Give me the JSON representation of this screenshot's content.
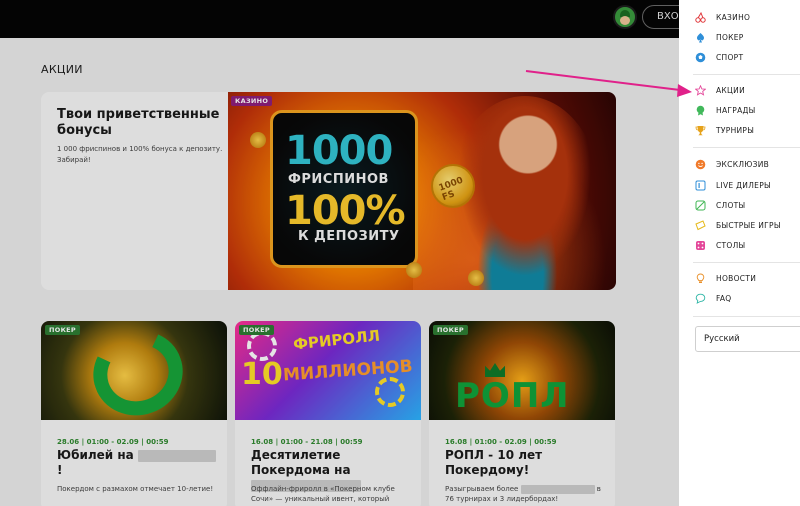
{
  "header": {
    "login_label": "ВХОД"
  },
  "page": {
    "title": "АКЦИИ"
  },
  "hero": {
    "badge": "КАЗИНО",
    "title": "Твои приветственные бонусы",
    "text": "1 000 фриспинов и 100% бонуса к депозиту. Забирай!",
    "image_text": {
      "line1": "1000",
      "line2": "ФРИСПИНОВ",
      "line3": "100%",
      "line4": "К ДЕПОЗИТУ",
      "coin": "1000 FS"
    }
  },
  "cards": [
    {
      "badge": "ПОКЕР",
      "date": "28.06 | 01:00 - 02.09 | 00:59",
      "title_start": "Юбилей на",
      "title_end": "!",
      "text": "Покердом с размахом отмечает 10-летие!"
    },
    {
      "badge": "ПОКЕР",
      "date": "16.08 | 01:00 - 21.08 | 00:59",
      "title_start": "Десятилетие Покердома на",
      "text": "Оффлайн-фриролл в «Покерном клубе Сочи» — уникальный ивент, который нельзя",
      "image_text": {
        "line1": "ФРИРОЛЛ",
        "line2": "10",
        "line3": "МИЛЛИОНОВ"
      }
    },
    {
      "badge": "ПОКЕР",
      "date": "16.08 | 01:00 - 02.09 | 00:59",
      "title_start": "РОПЛ - 10 лет Покердому!",
      "text_start": "Разыгрываем более",
      "text_end": "в 76 турнирах и 3 лидербордах!",
      "image_text": {
        "line1": "РОПЛ"
      }
    }
  ],
  "menu": {
    "items": [
      {
        "label": "КАЗИНО",
        "icon": "cherries-icon",
        "color": "#e0373b"
      },
      {
        "label": "ПОКЕР",
        "icon": "spade-icon",
        "color": "#2f8fd8"
      },
      {
        "label": "СПОРТ",
        "icon": "soccer-ball-icon",
        "color": "#2f8fd8"
      },
      {
        "label": "АКЦИИ",
        "icon": "star-icon",
        "color": "#e4489a"
      },
      {
        "label": "НАГРАДЫ",
        "icon": "medal-icon",
        "color": "#41b85b"
      },
      {
        "label": "ТУРНИРЫ",
        "icon": "trophy-icon",
        "color": "#e6a21a"
      },
      {
        "label": "ЭКСКЛЮЗИВ",
        "icon": "smiley-icon",
        "color": "#f07a2a"
      },
      {
        "label": "LIVE ДИЛЕРЫ",
        "icon": "live-icon",
        "color": "#2f8fd8"
      },
      {
        "label": "СЛОТЫ",
        "icon": "slot-icon",
        "color": "#3fb653"
      },
      {
        "label": "БЫСТРЫЕ ИГРЫ",
        "icon": "ticket-icon",
        "color": "#e6b91a"
      },
      {
        "label": "СТОЛЫ",
        "icon": "dice-icon",
        "color": "#e4489a"
      },
      {
        "label": "НОВОСТИ",
        "icon": "bulb-icon",
        "color": "#e9902a"
      },
      {
        "label": "FAQ",
        "icon": "chat-icon",
        "color": "#2fb6a6"
      }
    ],
    "language": "Русский"
  },
  "annotation": {
    "arrow_color": "#e0218a"
  }
}
